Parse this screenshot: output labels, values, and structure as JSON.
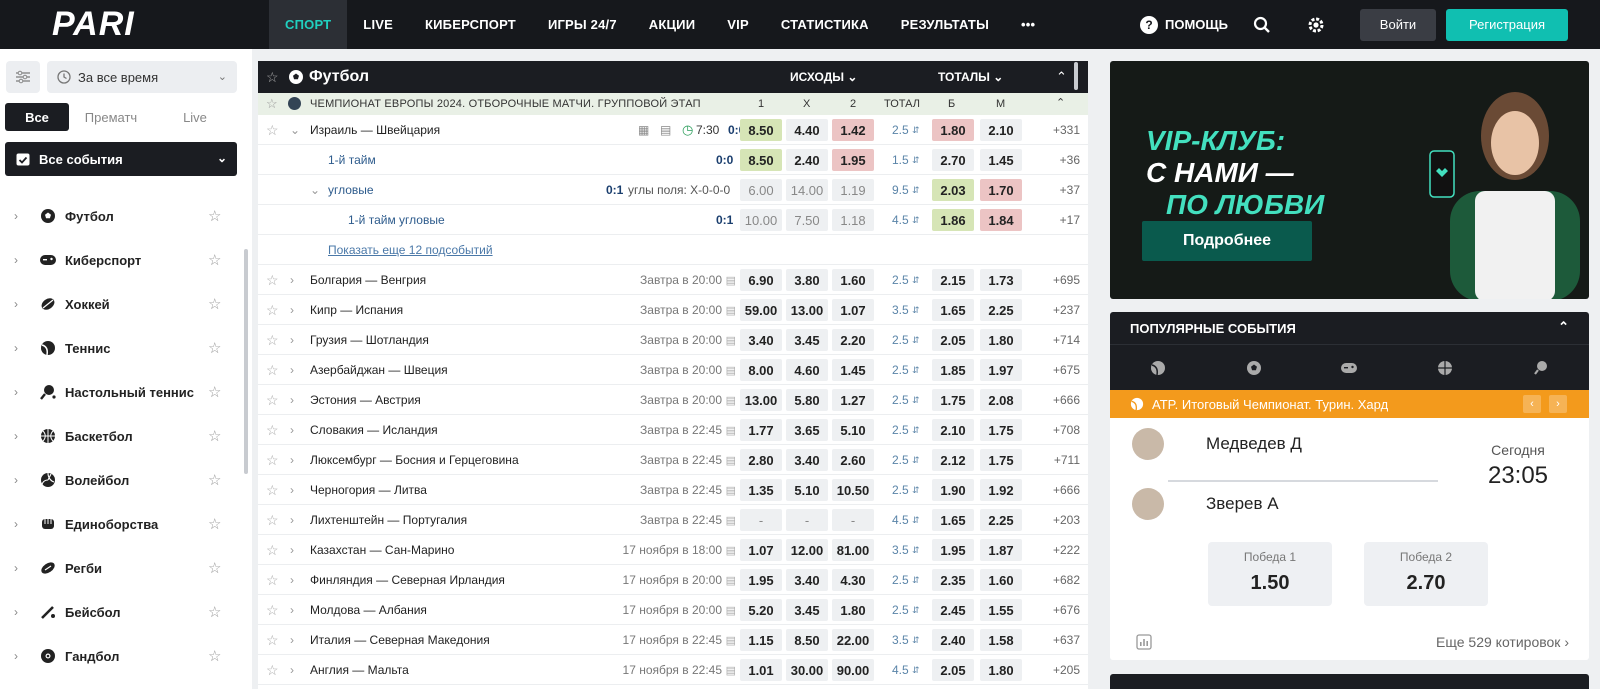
{
  "header": {
    "logo": "PARI",
    "nav": [
      "СПОРТ",
      "LIVE",
      "КИБЕРСПОРТ",
      "ИГРЫ 24/7",
      "АКЦИИ",
      "VIP",
      "СТАТИСТИКА",
      "РЕЗУЛЬТАТЫ",
      "•••"
    ],
    "help": "ПОМОЩЬ",
    "login": "Войти",
    "register": "Регистрация",
    "accent": "#10bfb1"
  },
  "sidebar": {
    "time_filter": "За все время",
    "segments": [
      "Все",
      "Прематч",
      "Live"
    ],
    "all_events": "Все события",
    "sports": [
      {
        "label": "Футбол",
        "icon": "football-icon"
      },
      {
        "label": "Киберспорт",
        "icon": "gamepad-icon"
      },
      {
        "label": "Хоккей",
        "icon": "hockey-icon"
      },
      {
        "label": "Теннис",
        "icon": "tennis-icon"
      },
      {
        "label": "Настольный теннис",
        "icon": "table-tennis-icon"
      },
      {
        "label": "Баскетбол",
        "icon": "basketball-icon"
      },
      {
        "label": "Волейбол",
        "icon": "volleyball-icon"
      },
      {
        "label": "Единоборства",
        "icon": "fist-icon"
      },
      {
        "label": "Регби",
        "icon": "rugby-icon"
      },
      {
        "label": "Бейсбол",
        "icon": "baseball-icon"
      },
      {
        "label": "Гандбол",
        "icon": "handball-icon"
      }
    ]
  },
  "main": {
    "sport_title": "Футбол",
    "col_outcomes": "ИСХОДЫ",
    "col_totals": "ТОТАЛЫ",
    "league": "ЧЕМПИОНАТ ЕВРОПЫ 2024. ОТБОРОЧНЫЕ МАТЧИ. ГРУППОВОЙ ЭТАП",
    "col_labels": [
      "1",
      "X",
      "2",
      "ТОТАЛ",
      "Б",
      "М"
    ],
    "live_match": {
      "name": "Израиль — Швейцария",
      "time": "7:30",
      "score": "0:0",
      "odds": [
        "8.50",
        "4.40",
        "1.42"
      ],
      "total": "2.5",
      "over": "1.80",
      "under": "2.10",
      "more": "+331"
    },
    "sub_events": [
      {
        "name": "1-й тайм",
        "info": "",
        "score": "0:0",
        "odds": [
          "8.50",
          "2.40",
          "1.95"
        ],
        "total": "1.5",
        "over": "2.70",
        "under": "1.45",
        "more": "+36"
      },
      {
        "name": "угловые",
        "info": "углы поля: Х-0-0-0",
        "score": "0:1",
        "odds": [
          "6.00",
          "14.00",
          "1.19"
        ],
        "total": "9.5",
        "over": "2.03",
        "under": "1.70",
        "more": "+37"
      },
      {
        "name": "1-й тайм угловые",
        "info": "",
        "score": "0:1",
        "odds": [
          "10.00",
          "7.50",
          "1.18"
        ],
        "total": "4.5",
        "over": "1.86",
        "under": "1.84",
        "more": "+17"
      }
    ],
    "show_more": "Показать еще 12 подсобытий",
    "matches": [
      {
        "name": "Болгария — Венгрия",
        "time": "Завтра в 20:00",
        "odds": [
          "6.90",
          "3.80",
          "1.60"
        ],
        "total": "2.5",
        "over": "2.15",
        "under": "1.73",
        "more": "+695"
      },
      {
        "name": "Кипр — Испания",
        "time": "Завтра в 20:00",
        "odds": [
          "59.00",
          "13.00",
          "1.07"
        ],
        "total": "3.5",
        "over": "1.65",
        "under": "2.25",
        "more": "+237"
      },
      {
        "name": "Грузия — Шотландия",
        "time": "Завтра в 20:00",
        "odds": [
          "3.40",
          "3.45",
          "2.20"
        ],
        "total": "2.5",
        "over": "2.05",
        "under": "1.80",
        "more": "+714"
      },
      {
        "name": "Азербайджан — Швеция",
        "time": "Завтра в 20:00",
        "odds": [
          "8.00",
          "4.60",
          "1.45"
        ],
        "total": "2.5",
        "over": "1.85",
        "under": "1.97",
        "more": "+675"
      },
      {
        "name": "Эстония — Австрия",
        "time": "Завтра в 20:00",
        "odds": [
          "13.00",
          "5.80",
          "1.27"
        ],
        "total": "2.5",
        "over": "1.75",
        "under": "2.08",
        "more": "+666"
      },
      {
        "name": "Словакия — Исландия",
        "time": "Завтра в 22:45",
        "odds": [
          "1.77",
          "3.65",
          "5.10"
        ],
        "total": "2.5",
        "over": "2.10",
        "under": "1.75",
        "more": "+708"
      },
      {
        "name": "Люксембург — Босния и Герцеговина",
        "time": "Завтра в 22:45",
        "odds": [
          "2.80",
          "3.40",
          "2.60"
        ],
        "total": "2.5",
        "over": "2.12",
        "under": "1.75",
        "more": "+711"
      },
      {
        "name": "Черногория — Литва",
        "time": "Завтра в 22:45",
        "odds": [
          "1.35",
          "5.10",
          "10.50"
        ],
        "total": "2.5",
        "over": "1.90",
        "under": "1.92",
        "more": "+666"
      },
      {
        "name": "Лихтенштейн — Португалия",
        "time": "Завтра в 22:45",
        "odds": [
          "-",
          "-",
          "-"
        ],
        "total": "4.5",
        "over": "1.65",
        "under": "2.25",
        "more": "+203"
      },
      {
        "name": "Казахстан — Сан-Марино",
        "time": "17 ноября в 18:00",
        "odds": [
          "1.07",
          "12.00",
          "81.00"
        ],
        "total": "3.5",
        "over": "1.95",
        "under": "1.87",
        "more": "+222"
      },
      {
        "name": "Финляндия — Северная Ирландия",
        "time": "17 ноября в 20:00",
        "odds": [
          "1.95",
          "3.40",
          "4.30"
        ],
        "total": "2.5",
        "over": "2.35",
        "under": "1.60",
        "more": "+682"
      },
      {
        "name": "Молдова — Албания",
        "time": "17 ноября в 20:00",
        "odds": [
          "5.20",
          "3.45",
          "1.80"
        ],
        "total": "2.5",
        "over": "2.45",
        "under": "1.55",
        "more": "+676"
      },
      {
        "name": "Италия — Северная Македония",
        "time": "17 ноября в 22:45",
        "odds": [
          "1.15",
          "8.50",
          "22.00"
        ],
        "total": "3.5",
        "over": "2.40",
        "under": "1.58",
        "more": "+637"
      },
      {
        "name": "Англия — Мальта",
        "time": "17 ноября в 22:45",
        "odds": [
          "1.01",
          "30.00",
          "90.00"
        ],
        "total": "4.5",
        "over": "2.05",
        "under": "1.80",
        "more": "+205"
      }
    ]
  },
  "banner": {
    "line1": "VIP-КЛУБ:",
    "line2": "С НАМИ —",
    "line3": "ПО ЛЮБВИ",
    "button": "Подробнее"
  },
  "popular": {
    "title": "ПОПУЛЯРНЫЕ СОБЫТИЯ",
    "league": "ATP. Итоговый Чемпионат. Турин. Хард",
    "player1": "Медведев Д",
    "player2": "Зверев А",
    "date": "Сегодня",
    "time": "23:05",
    "win1_label": "Победа 1",
    "win1_value": "1.50",
    "win2_label": "Победа 2",
    "win2_value": "2.70",
    "more_quotes": "Еще 529 котировок"
  }
}
